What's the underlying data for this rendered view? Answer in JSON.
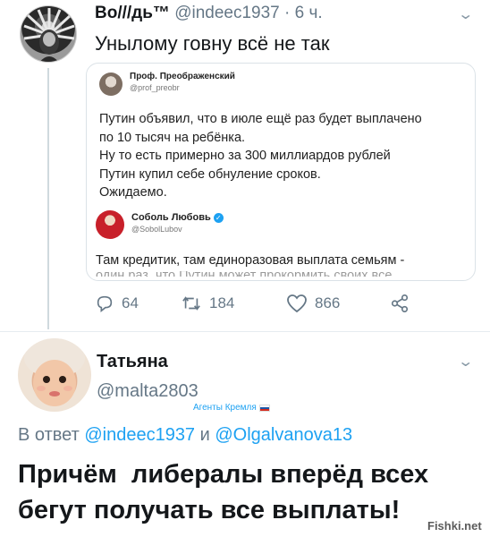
{
  "tweet1": {
    "name": "Во///дь™",
    "handle": "@indeec1937",
    "time": "· 6 ч.",
    "text": "Унылому говну всё не так",
    "quote": {
      "name": "Проф. Преображенский",
      "handle": "@prof_preobr",
      "lines": [
        "Путин объявил, что в июле ещё раз будет выплачено",
        "по 10 тысяч на ребёнка.",
        "Ну то есть примерно за 300 миллиардов рублей",
        "Путин купил себе обнуление сроков.",
        "Ожидаемо."
      ],
      "inner": {
        "name": "Соболь Любовь",
        "handle": "@SobolLubov",
        "text": "Там кредитик, там единоразовая выплата семьям -",
        "cut_text": "один раз, что Путин может прокормить своих все"
      }
    },
    "actions": {
      "replies": "64",
      "retweets": "184",
      "likes": "866"
    },
    "icons": [
      "reply-icon",
      "retweet-icon",
      "like-icon",
      "share-icon",
      "chevron-down-icon"
    ]
  },
  "tweet2": {
    "name": "Татьяна",
    "handle": "@malta2803",
    "label": "Агенты Кремля",
    "reply_prefix": "В ответ",
    "mention1": "@indeec1937",
    "conj": "и",
    "mention2": "@Olgalvanova13",
    "text_line1": "Причём  либералы вперёд всех",
    "text_line2": "бегут получать все выплаты!"
  },
  "watermark": "Fishki.net",
  "colors": {
    "accent": "#1da1f2",
    "muted": "#657786",
    "text": "#14171a",
    "border": "#dbe2e7"
  }
}
